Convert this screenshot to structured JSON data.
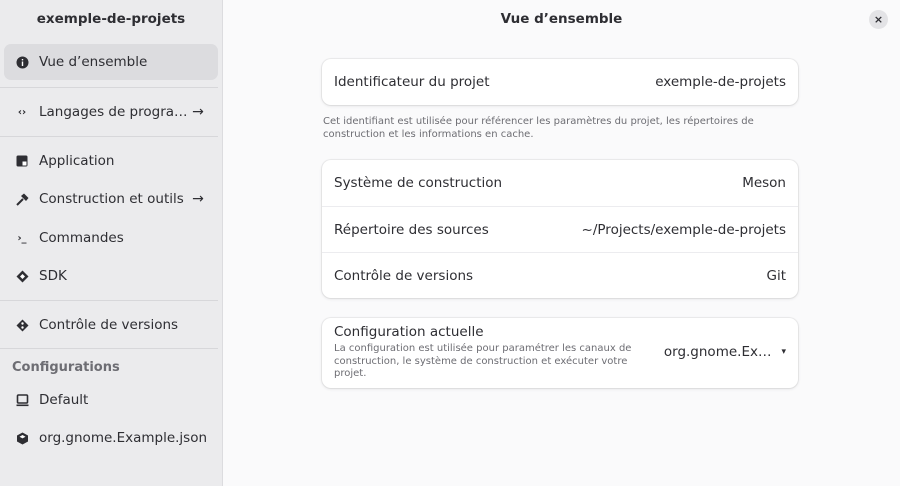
{
  "sidebar": {
    "title": "exemple-de-projets",
    "items": [
      {
        "label": "Vue d’ensemble",
        "icon": "info-icon",
        "arrow": ""
      },
      {
        "label": "Langages de progra…",
        "icon": "code-icon",
        "arrow": "→"
      },
      {
        "label": "Application",
        "icon": "application-icon",
        "arrow": ""
      },
      {
        "label": "Construction et outils",
        "icon": "hammer-icon",
        "arrow": "→"
      },
      {
        "label": "Commandes",
        "icon": "terminal-icon",
        "arrow": ""
      },
      {
        "label": "SDK",
        "icon": "sdk-icon",
        "arrow": ""
      },
      {
        "label": "Contrôle de versions",
        "icon": "git-icon",
        "arrow": ""
      }
    ],
    "section_label": "Configurations",
    "configs": [
      {
        "label": "Default",
        "icon": "computer-icon"
      },
      {
        "label": "org.gnome.Example.json",
        "icon": "package-icon"
      }
    ]
  },
  "main": {
    "title": "Vue d’ensemble",
    "close_glyph": "×",
    "project": {
      "key": "Identificateur du projet",
      "value": "exemple-de-projets",
      "caption": "Cet identifiant est utilisée pour référencer les paramètres du projet, les répertoires de construction et les informations en cache."
    },
    "build": [
      {
        "key": "Système de construction",
        "value": "Meson"
      },
      {
        "key": "Répertoire des sources",
        "value": "~/Projects/exemple-de-projets"
      },
      {
        "key": "Contrôle de versions",
        "value": "Git"
      }
    ],
    "config": {
      "title": "Configuration actuelle",
      "description": "La configuration est utilisée pour paramétrer les canaux de construction, le système de construction et exécuter votre projet.",
      "selected": "org.gnome.Ex…",
      "caret": "▾"
    }
  }
}
